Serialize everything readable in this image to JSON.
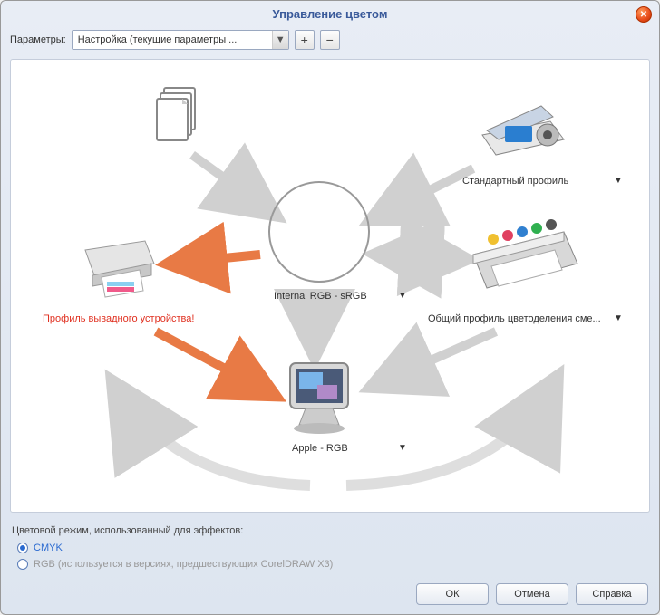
{
  "title": "Управление цветом",
  "params": {
    "label": "Параметры:",
    "selected": "Настройка (текущие параметры ..."
  },
  "diagram": {
    "source": {
      "label": ""
    },
    "scanner": {
      "label": "Стандартный профиль"
    },
    "rgb_center": {
      "label": "Internal RGB - sRGB"
    },
    "printer": {
      "label": "Профиль вывадного устройства!"
    },
    "press": {
      "label": "Общий профиль цветоделения сме..."
    },
    "monitor": {
      "label": "Apple - RGB"
    }
  },
  "effects": {
    "heading": "Цветовой режим, использованный для эффектов:",
    "cmyk": "CMYK",
    "rgb": "RGB (используется в версиях, предшествующих CorelDRAW X3)"
  },
  "buttons": {
    "ok": "ОК",
    "cancel": "Отмена",
    "help": "Справка"
  }
}
